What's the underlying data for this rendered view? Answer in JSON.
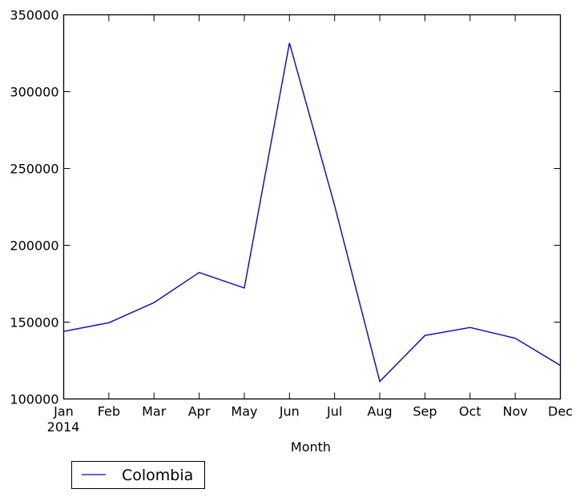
{
  "chart_data": {
    "type": "line",
    "title": "",
    "xlabel": "Month",
    "ylabel": "",
    "categories": [
      "Jan",
      "Feb",
      "Mar",
      "Apr",
      "May",
      "Jun",
      "Jul",
      "Aug",
      "Sep",
      "Oct",
      "Nov",
      "Dec"
    ],
    "year_label": "2014",
    "series": [
      {
        "name": "Colombia",
        "color": "#0000ff",
        "values": [
          144000,
          149600,
          162700,
          182300,
          172200,
          331700,
          225900,
          111400,
          141300,
          146500,
          139500,
          121800
        ]
      }
    ],
    "ylim": [
      100000,
      350000
    ],
    "yticks": [
      100000,
      150000,
      200000,
      250000,
      300000,
      350000
    ],
    "ytick_labels": [
      "100000",
      "150000",
      "200000",
      "250000",
      "300000",
      "350000"
    ],
    "grid": false,
    "legend": {
      "placement": "below-left",
      "entries": [
        "Colombia"
      ]
    }
  }
}
